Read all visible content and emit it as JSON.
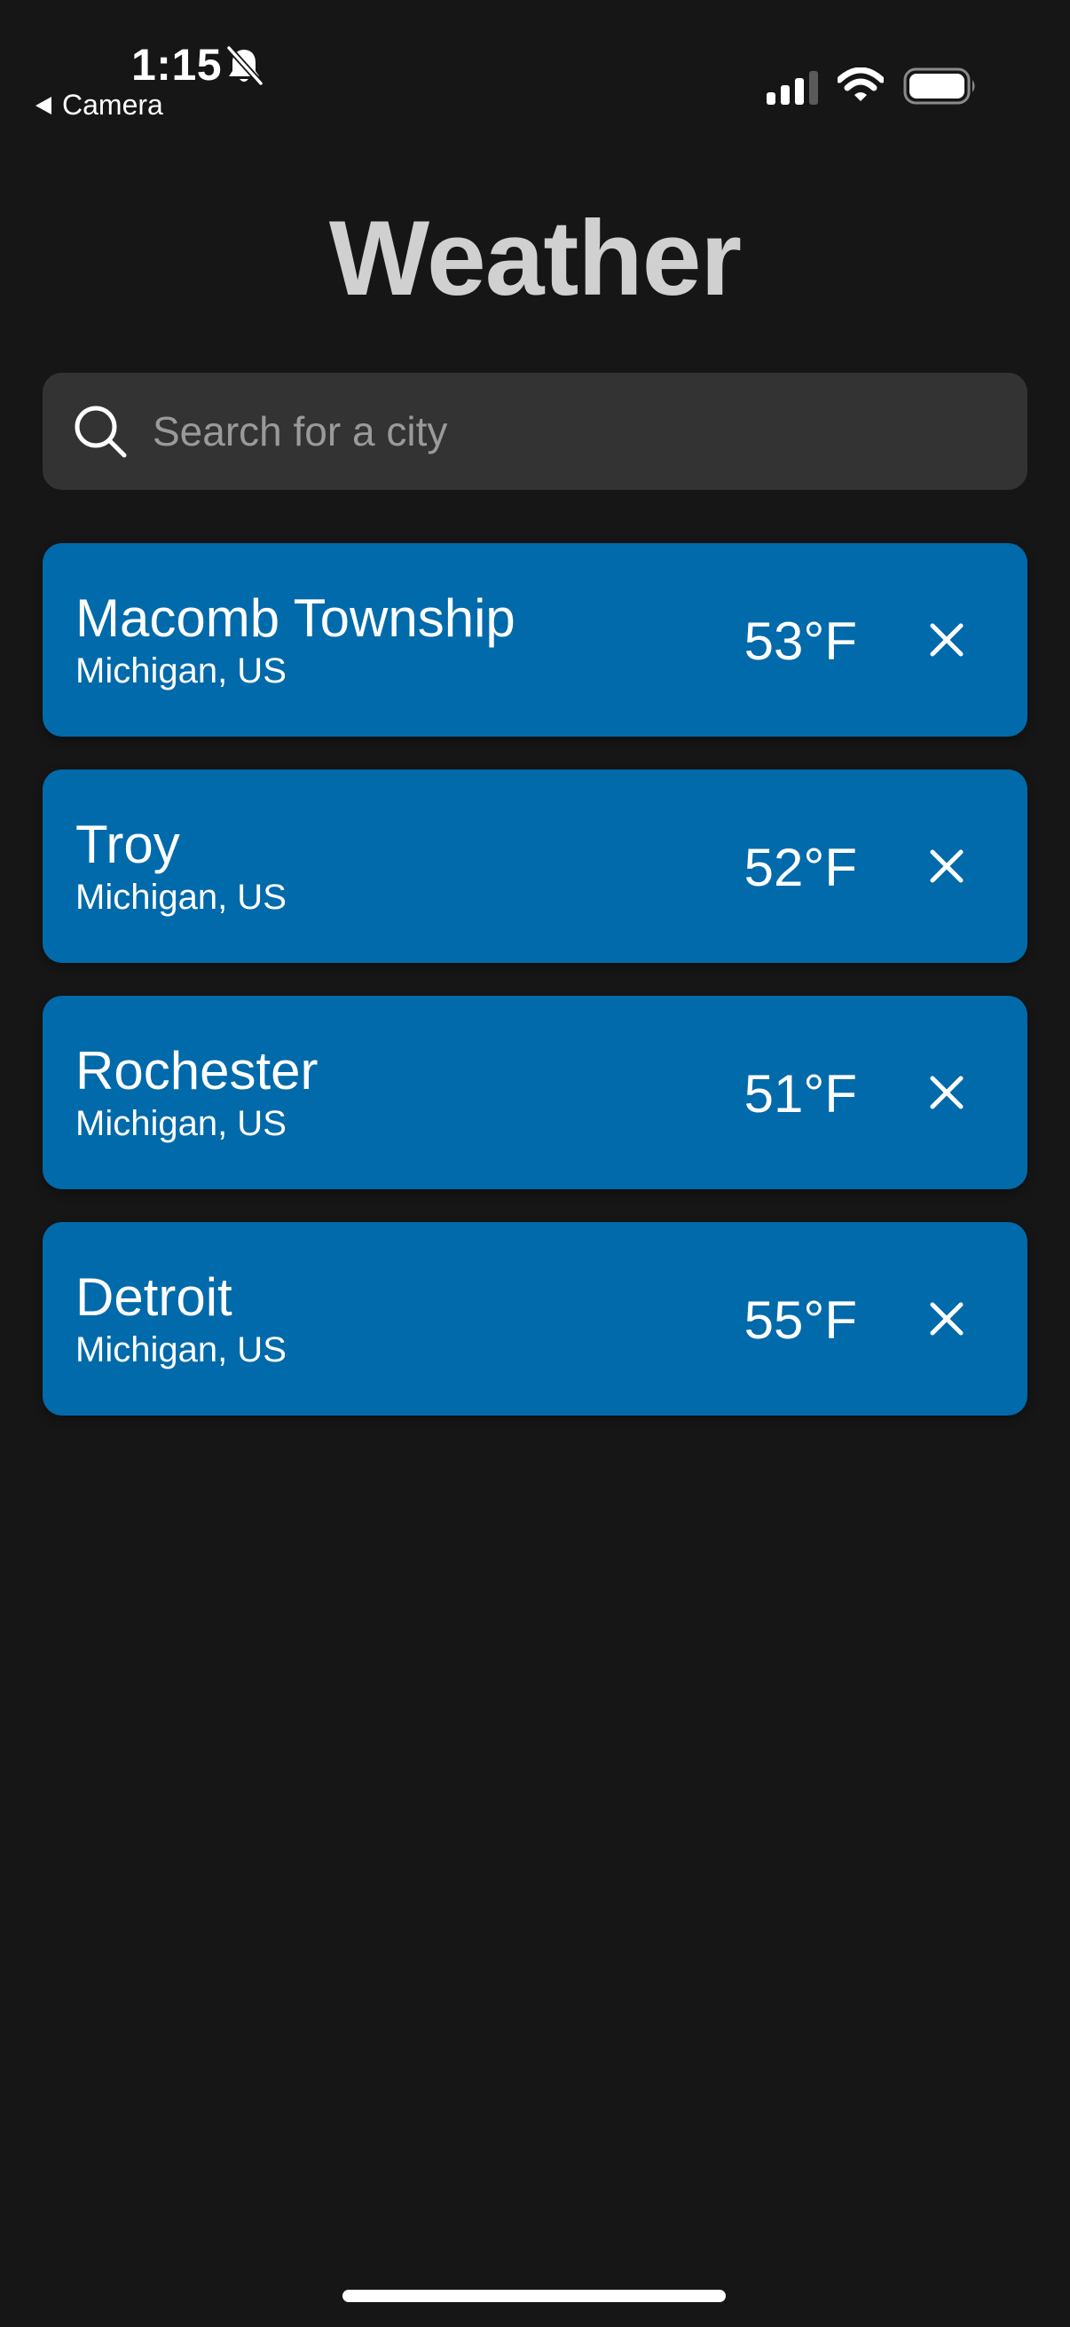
{
  "status_bar": {
    "time": "1:15",
    "back_label": "Camera",
    "icons": [
      "bell-slash-icon",
      "cellular-signal-icon",
      "wifi-icon",
      "battery-icon"
    ]
  },
  "title": "Weather",
  "search": {
    "placeholder": "Search for a city",
    "value": ""
  },
  "cities": [
    {
      "name": "Macomb Township",
      "region": "Michigan, US",
      "temp": "53°F"
    },
    {
      "name": "Troy",
      "region": "Michigan, US",
      "temp": "52°F"
    },
    {
      "name": "Rochester",
      "region": "Michigan, US",
      "temp": "51°F"
    },
    {
      "name": "Detroit",
      "region": "Michigan, US",
      "temp": "55°F"
    }
  ],
  "colors": {
    "background": "#161616",
    "card": "#016aaa",
    "search_bg": "#333333",
    "title": "#d0d0d0",
    "placeholder": "#9a9a9a"
  }
}
